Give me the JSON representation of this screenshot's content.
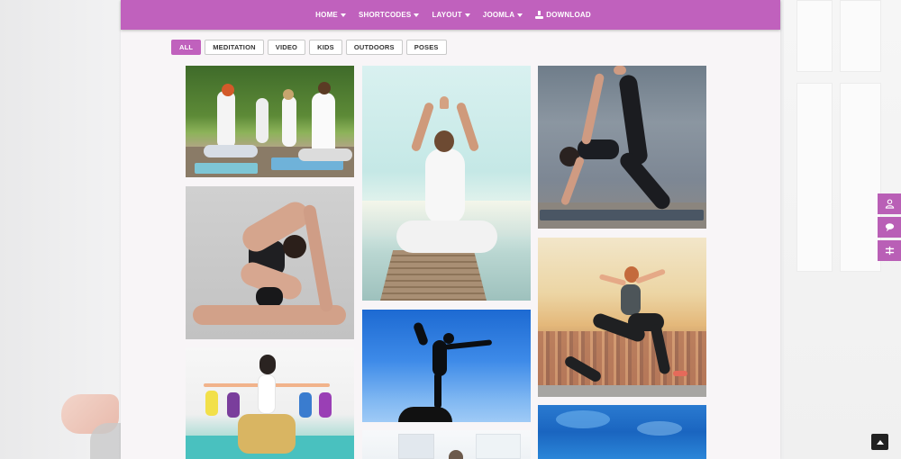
{
  "nav": {
    "items": [
      {
        "label": "HOME",
        "caret": true
      },
      {
        "label": "SHORTCODES",
        "caret": true
      },
      {
        "label": "LAYOUT",
        "caret": true
      },
      {
        "label": "JOOMLA",
        "caret": true
      },
      {
        "label": "DOWNLOAD",
        "icon": "download-icon"
      }
    ]
  },
  "filters": {
    "all": "ALL",
    "meditation": "MEDITATION",
    "video": "VIDEO",
    "kids": "KIDS",
    "outdoors": "OUTDOORS",
    "poses": "POSES",
    "active": "ALL"
  },
  "gallery": {
    "images": [
      {
        "subject": "group meditation outdoors"
      },
      {
        "subject": "lotus pose on pier by the sea"
      },
      {
        "subject": "side plank against concrete wall"
      },
      {
        "subject": "king pigeon pose on grey background"
      },
      {
        "subject": "dancer pose silhouette against blue sky"
      },
      {
        "subject": "warrior pose over city at sunset"
      },
      {
        "subject": "kids yoga class"
      },
      {
        "subject": "woman in bright room"
      },
      {
        "subject": "blue water"
      }
    ]
  },
  "side_buttons": [
    "user-icon",
    "chat-icon",
    "settings-icon"
  ],
  "colors": {
    "accent": "#c061bd",
    "side": "#b95fb6"
  }
}
